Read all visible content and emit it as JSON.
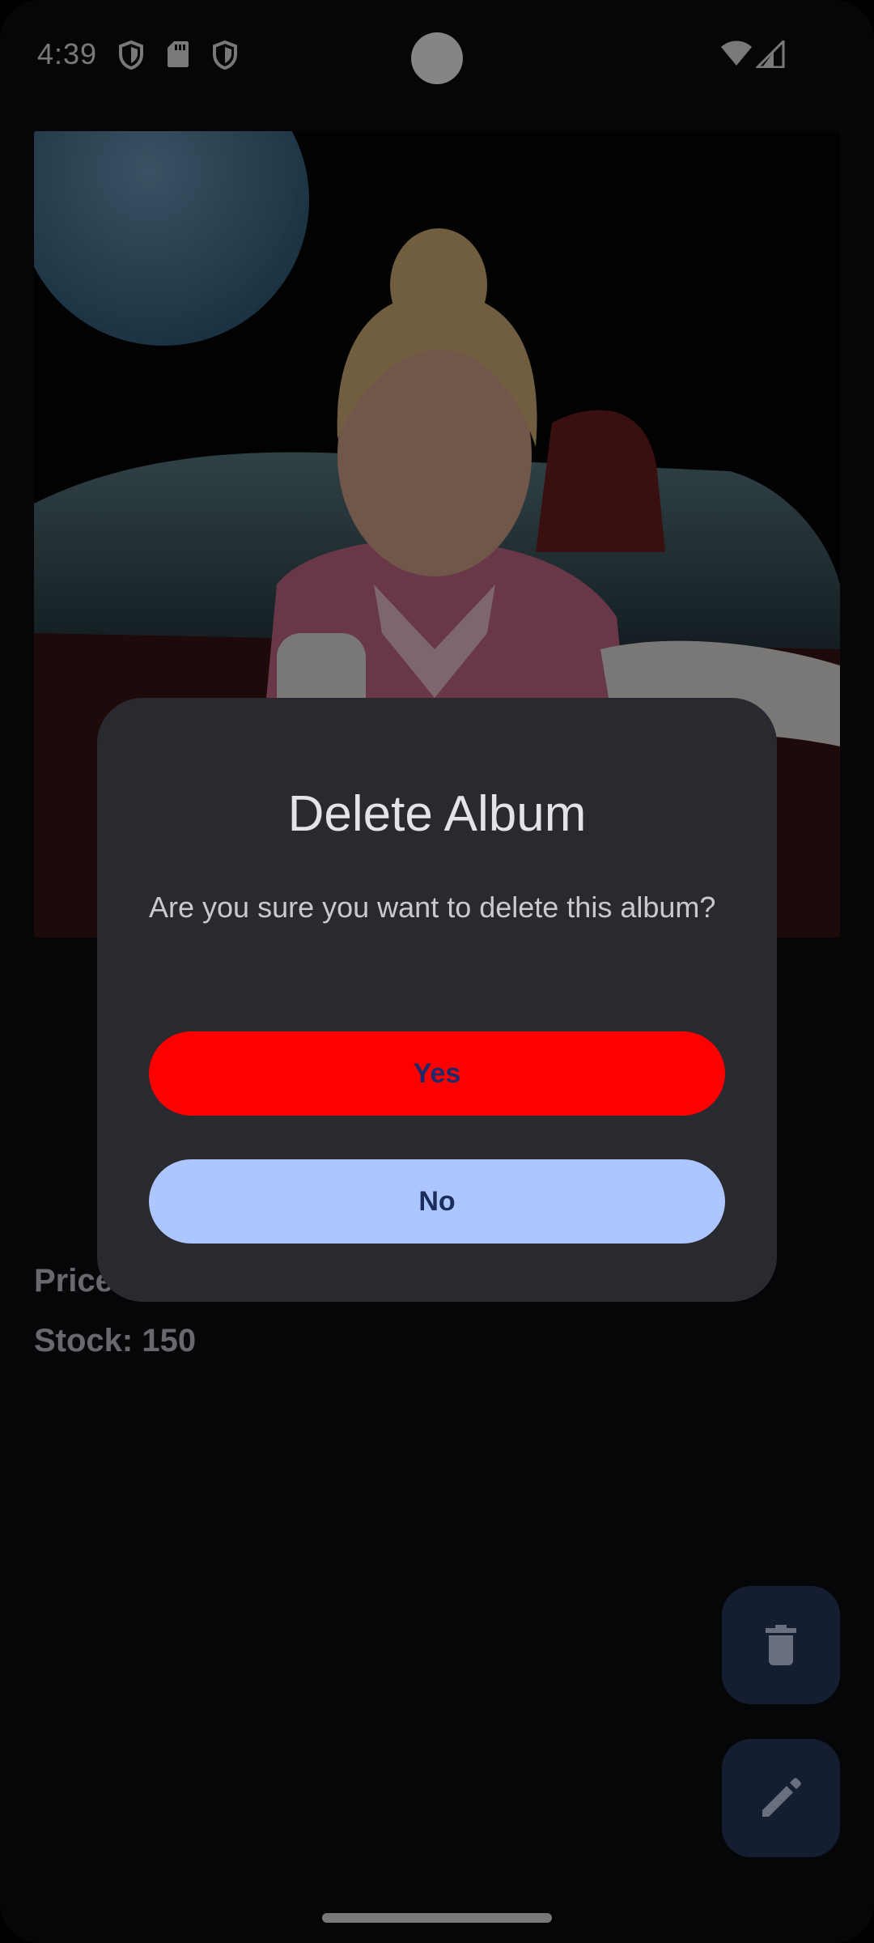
{
  "status_bar": {
    "time": "4:39",
    "icons": [
      "shield-icon",
      "sd-card-icon",
      "shield-icon",
      "wifi-icon",
      "cellular-signal-icon"
    ]
  },
  "album": {
    "art_description_icon": "album-cover-image",
    "price_label": "Price",
    "stock_label": "Stock: 150"
  },
  "dialog": {
    "title": "Delete Album",
    "message": "Are you sure you want to delete this album?",
    "yes_label": "Yes",
    "no_label": "No"
  },
  "fabs": {
    "delete_icon": "trash-icon",
    "edit_icon": "pencil-icon"
  },
  "colors": {
    "background": "#0b0d11",
    "dialog_surface": "#292a2f",
    "yes_button": "#ff0000",
    "no_button": "#adc6ff",
    "fab_container": "#283a5d"
  }
}
